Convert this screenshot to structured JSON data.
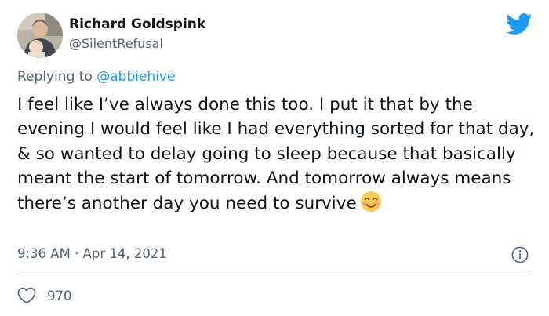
{
  "author": {
    "display_name": "Richard Goldspink",
    "handle": "@SilentRefusal",
    "avatar_icon": "user-avatar-photo"
  },
  "brand": {
    "icon": "twitter-bird-icon",
    "color": "#1d9bf0"
  },
  "reply": {
    "prefix": "Replying to",
    "handle": "@abbiehive"
  },
  "tweet": {
    "text": "I feel like I’ve always done this too. I put it that by the evening I would feel like I had everything sorted for that day, & so wanted to delay going to sleep because that basically meant the start of tomorrow. And tomorrow always means there’s another day you need to survive",
    "emoji": "smiling-face-with-smiling-eyes-icon"
  },
  "meta": {
    "timestamp": "9:36 AM · Apr 14, 2021"
  },
  "stats": {
    "likes": "970"
  },
  "colors": {
    "text": "#0f1419",
    "secondary": "#536471",
    "accent": "#1d9bf0",
    "divider": "#cfd9de"
  }
}
